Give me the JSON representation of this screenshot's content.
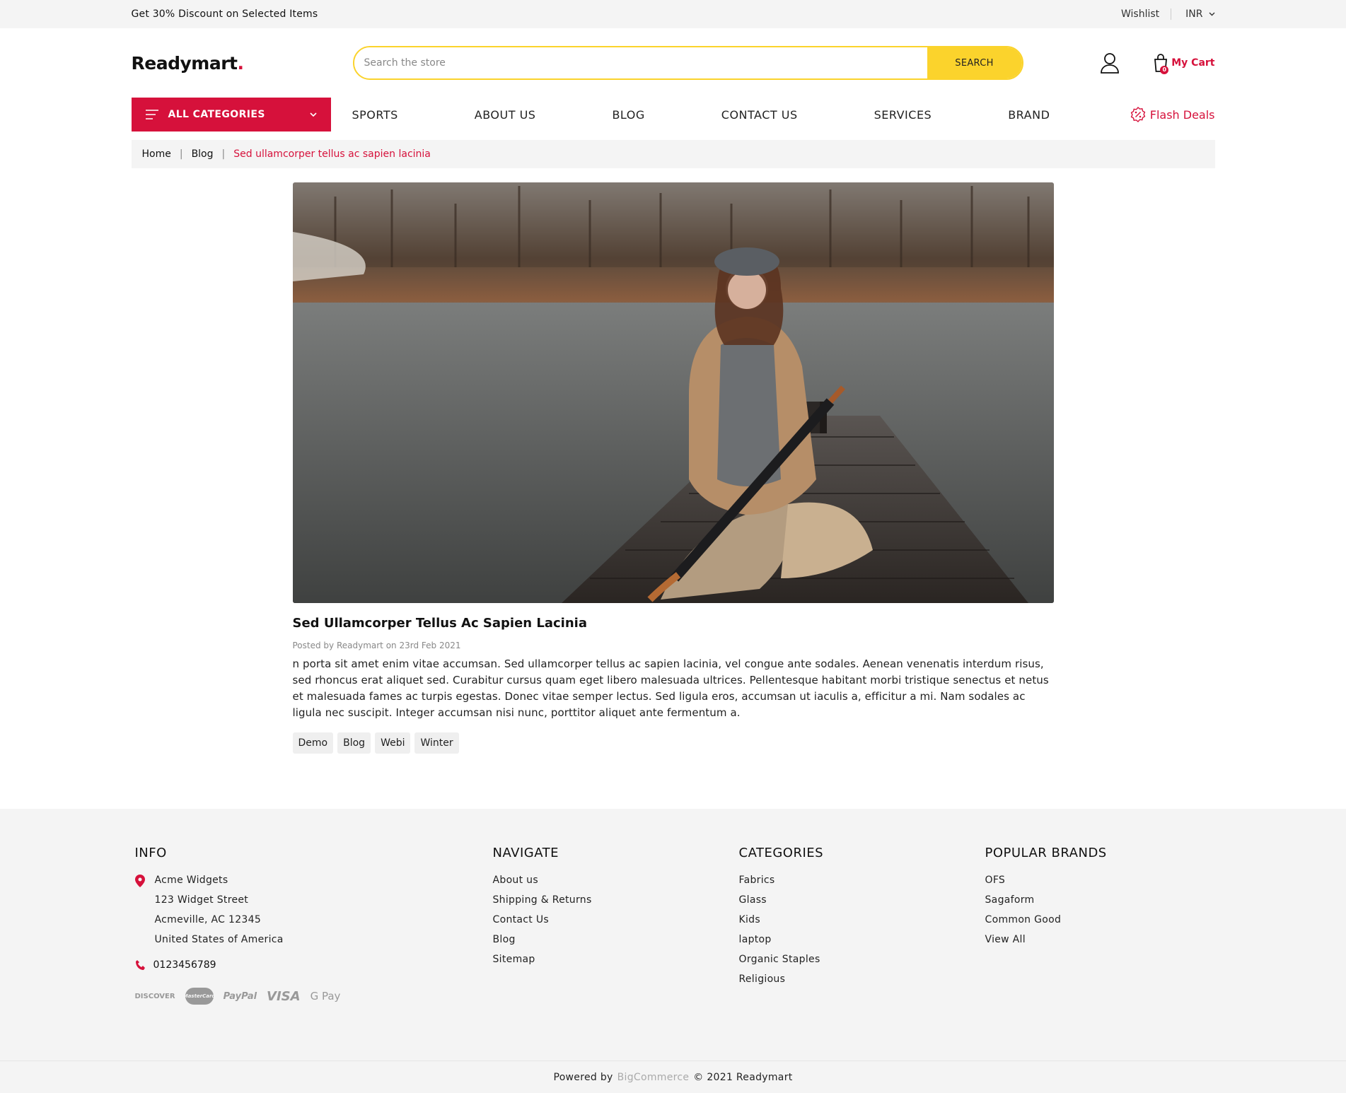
{
  "topbar": {
    "promo": "Get 30% Discount on Selected Items",
    "wishlist": "Wishlist",
    "currency": "INR"
  },
  "header": {
    "logo_text": "Readymart",
    "logo_dot": ".",
    "search_placeholder": "Search the store",
    "search_button": "SEARCH",
    "cart_label": "My Cart",
    "cart_count": "0"
  },
  "nav": {
    "all_categories": "ALL CATEGORIES",
    "items": [
      "SPORTS",
      "ABOUT US",
      "BLOG",
      "CONTACT US",
      "SERVICES",
      "BRAND"
    ],
    "flash_deals": "Flash Deals"
  },
  "breadcrumb": [
    "Home",
    "Blog",
    "Sed ullamcorper tellus ac sapien lacinia"
  ],
  "post": {
    "title": "Sed Ullamcorper Tellus Ac Sapien Lacinia",
    "meta": "Posted by Readymart on 23rd Feb 2021",
    "body": "n porta sit amet enim vitae accumsan. Sed ullamcorper tellus ac sapien lacinia, vel congue ante sodales. Aenean venenatis interdum risus, sed rhoncus erat aliquet sed. Curabitur cursus quam eget libero malesuada ultrices. Pellentesque habitant morbi tristique senectus et netus et malesuada fames ac turpis egestas. Donec vitae semper lectus. Sed ligula eros, accumsan ut iaculis a, efficitur a mi. Nam sodales ac ligula nec suscipit. Integer accumsan nisi nunc, porttitor aliquet ante fermentum a.",
    "tags": [
      "Demo",
      "Blog",
      "Webi",
      "Winter"
    ]
  },
  "footer": {
    "info": {
      "title": "INFO",
      "address": [
        "Acme Widgets",
        "123 Widget Street",
        "Acmeville, AC 12345",
        "United States of America"
      ],
      "phone": "0123456789",
      "payments": [
        "DISCOVER",
        "MasterCard",
        "PayPal",
        "VISA",
        "G Pay"
      ]
    },
    "navigate": {
      "title": "NAVIGATE",
      "items": [
        "About us",
        "Shipping & Returns",
        "Contact Us",
        "Blog",
        "Sitemap"
      ]
    },
    "categories": {
      "title": "CATEGORIES",
      "items": [
        "Fabrics",
        "Glass",
        "Kids",
        "laptop",
        "Organic Staples",
        "Religious"
      ]
    },
    "brands": {
      "title": "POPULAR BRANDS",
      "items": [
        "OFS",
        "Sagaform",
        "Common Good",
        "View All"
      ]
    }
  },
  "bottom": {
    "powered": "Powered by",
    "platform": "BigCommerce",
    "copyright": "© 2021 Readymart"
  },
  "colors": {
    "accent": "#d6113b",
    "search": "#fbd32c",
    "panel": "#f4f4f4"
  }
}
